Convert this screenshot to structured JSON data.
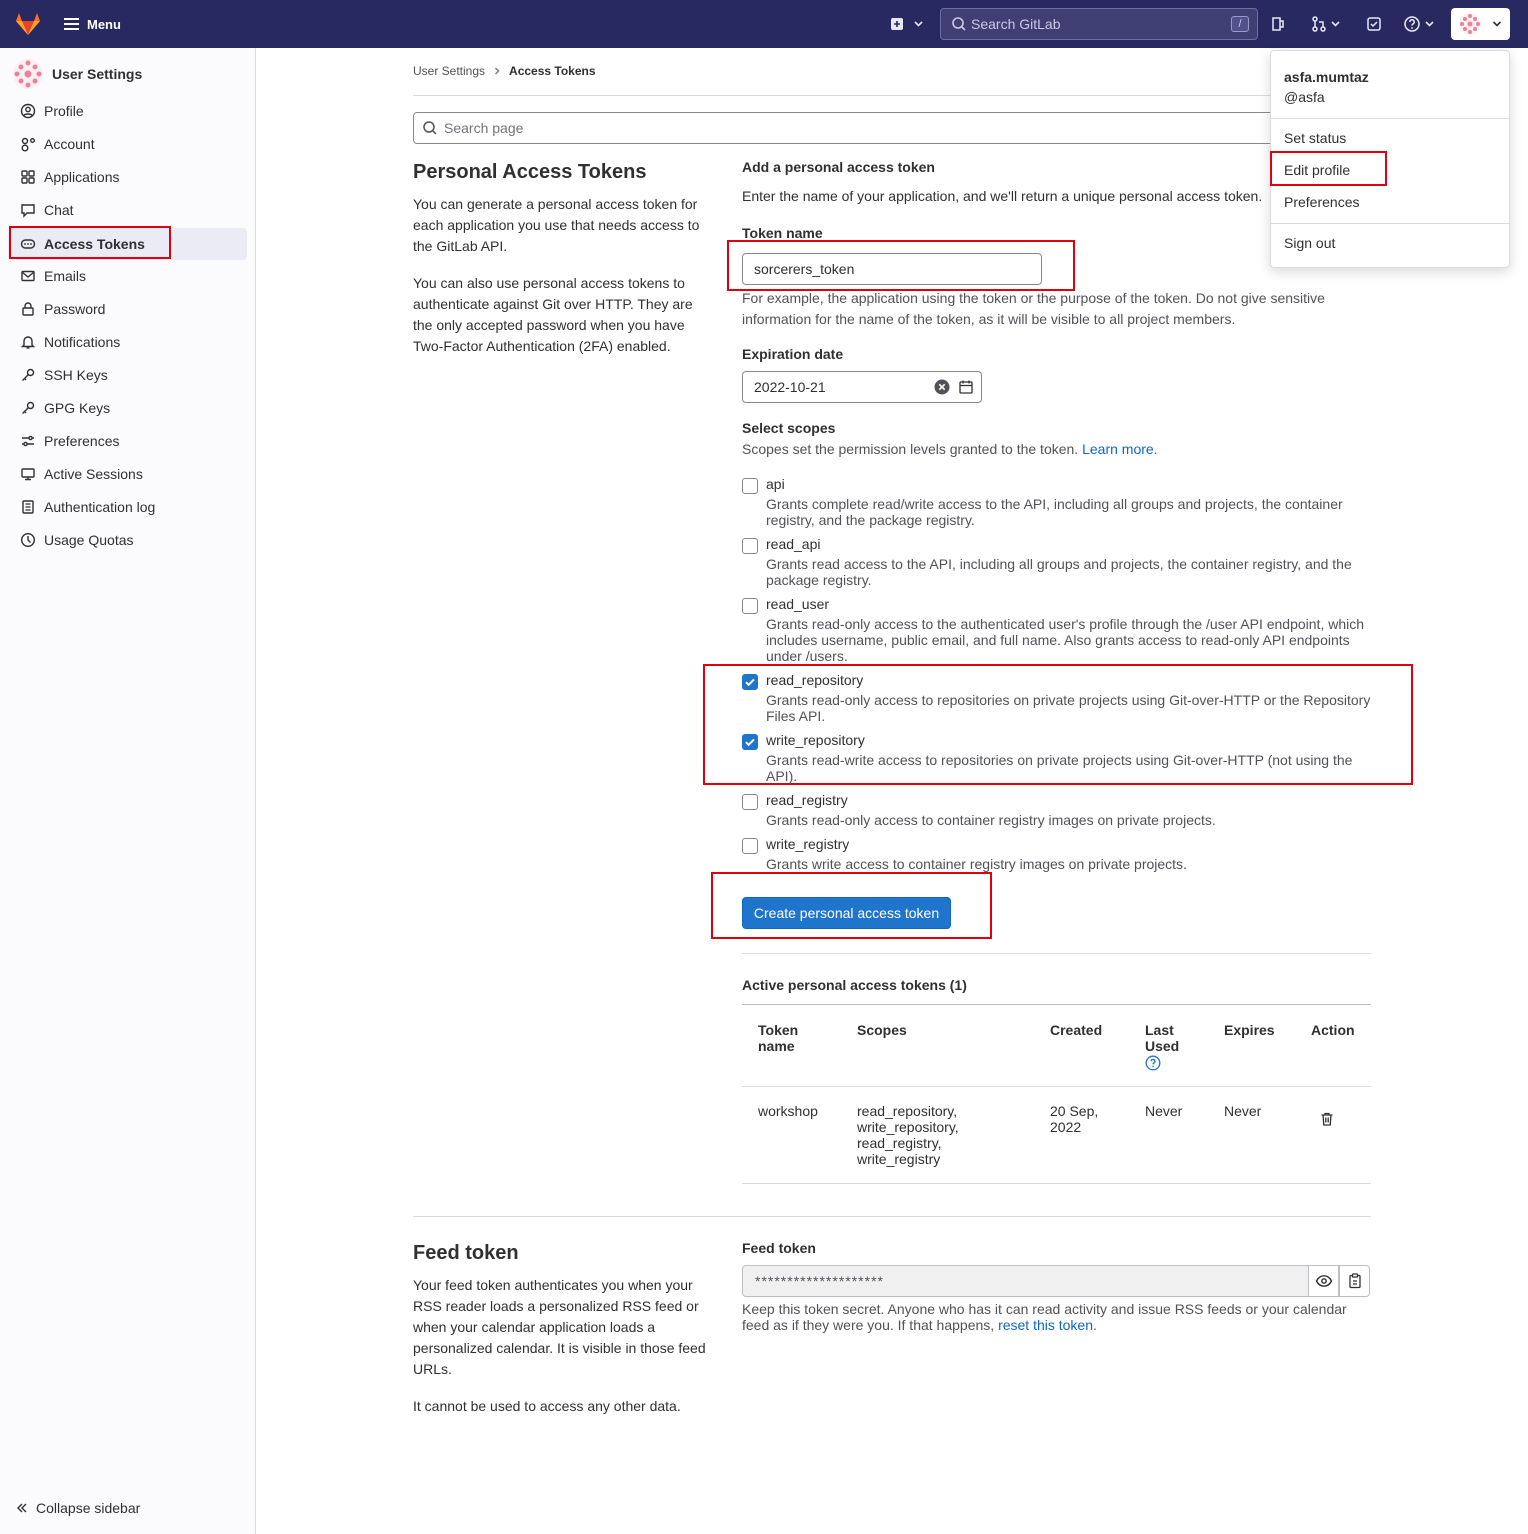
{
  "topbar": {
    "menu_label": "Menu",
    "search_placeholder": "Search GitLab",
    "search_shortcut": "/",
    "icons": [
      "plus-square-icon",
      "issues-icon",
      "merge-request-icon",
      "todo-icon",
      "help-icon"
    ]
  },
  "sidebar": {
    "title": "User Settings",
    "items": [
      {
        "label": "Profile",
        "icon": "profile-icon"
      },
      {
        "label": "Account",
        "icon": "account-icon"
      },
      {
        "label": "Applications",
        "icon": "applications-icon"
      },
      {
        "label": "Chat",
        "icon": "chat-icon"
      },
      {
        "label": "Access Tokens",
        "icon": "token-icon",
        "active": true
      },
      {
        "label": "Emails",
        "icon": "mail-icon"
      },
      {
        "label": "Password",
        "icon": "lock-icon"
      },
      {
        "label": "Notifications",
        "icon": "bell-icon"
      },
      {
        "label": "SSH Keys",
        "icon": "key-icon"
      },
      {
        "label": "GPG Keys",
        "icon": "key-icon"
      },
      {
        "label": "Preferences",
        "icon": "preferences-icon"
      },
      {
        "label": "Active Sessions",
        "icon": "sessions-icon"
      },
      {
        "label": "Authentication log",
        "icon": "log-icon"
      },
      {
        "label": "Usage Quotas",
        "icon": "quota-icon"
      }
    ],
    "collapse_label": "Collapse sidebar"
  },
  "breadcrumb": {
    "parent": "User Settings",
    "current": "Access Tokens"
  },
  "page_search_placeholder": "Search page",
  "pat": {
    "title": "Personal Access Tokens",
    "desc1": "You can generate a personal access token for each application you use that needs access to the GitLab API.",
    "desc2": "You can also use personal access tokens to authenticate against Git over HTTP. They are the only accepted password when you have Two-Factor Authentication (2FA) enabled.",
    "form_title": "Add a personal access token",
    "form_desc": "Enter the name of your application, and we'll return a unique personal access token.",
    "token_name_label": "Token name",
    "token_name_value": "sorcerers_token",
    "token_name_help": "For example, the application using the token or the purpose of the token. Do not give sensitive information for the name of the token, as it will be visible to all project members.",
    "expiration_label": "Expiration date",
    "expiration_value": "2022-10-21",
    "scopes_label": "Select scopes",
    "scopes_help": "Scopes set the permission levels granted to the token.",
    "learn_more": "Learn more.",
    "scopes": [
      {
        "name": "api",
        "checked": false,
        "desc": "Grants complete read/write access to the API, including all groups and projects, the container registry, and the package registry."
      },
      {
        "name": "read_api",
        "checked": false,
        "desc": "Grants read access to the API, including all groups and projects, the container registry, and the package registry."
      },
      {
        "name": "read_user",
        "checked": false,
        "desc": "Grants read-only access to the authenticated user's profile through the /user API endpoint, which includes username, public email, and full name. Also grants access to read-only API endpoints under /users."
      },
      {
        "name": "read_repository",
        "checked": true,
        "desc": "Grants read-only access to repositories on private projects using Git-over-HTTP or the Repository Files API."
      },
      {
        "name": "write_repository",
        "checked": true,
        "desc": "Grants read-write access to repositories on private projects using Git-over-HTTP (not using the API)."
      },
      {
        "name": "read_registry",
        "checked": false,
        "desc": "Grants read-only access to container registry images on private projects."
      },
      {
        "name": "write_registry",
        "checked": false,
        "desc": "Grants write access to container registry images on private projects."
      }
    ],
    "create_button": "Create personal access token",
    "active_title": "Active personal access tokens (1)",
    "table": {
      "headers": [
        "Token name",
        "Scopes",
        "Created",
        "Last Used",
        "Expires",
        "Action"
      ],
      "rows": [
        {
          "token_name": "workshop",
          "scopes": [
            "read_repository,",
            "write_repository,",
            "read_registry,",
            "write_registry"
          ],
          "created": [
            "20 Sep,",
            "2022"
          ],
          "last_used": "Never",
          "expires": "Never"
        }
      ]
    }
  },
  "feed": {
    "title": "Feed token",
    "desc1": "Your feed token authenticates you when your RSS reader loads a personalized RSS feed or when your calendar application loads a personalized calendar. It is visible in those feed URLs.",
    "desc2": "It cannot be used to access any other data.",
    "label": "Feed token",
    "value": "********************",
    "help": "Keep this token secret. Anyone who has it can read activity and issue RSS feeds or your calendar feed as if they were you. If that happens,",
    "reset_link": "reset this token",
    "help_end": "."
  },
  "user_menu": {
    "name": "asfa.mumtaz",
    "handle": "@asfa",
    "items": [
      "Set status",
      "Edit profile",
      "Preferences",
      "Sign out"
    ]
  },
  "colors": {
    "topbar": "#292961",
    "primary": "#1f75cb",
    "highlight": "#e1000e"
  }
}
